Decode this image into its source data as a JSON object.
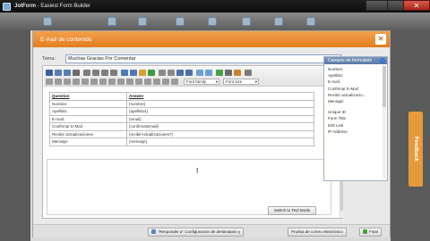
{
  "window": {
    "title_prefix": "JotForm",
    "title_suffix": " - Easiest Form Builder",
    "close_glyph": "✕"
  },
  "side_tab": {
    "label": "Feedback"
  },
  "modal": {
    "title": "E-mail de contenido",
    "close_glyph": "✕"
  },
  "subject": {
    "label": "Tema:",
    "value": "Muchas Gracias Por Comentar"
  },
  "editor": {
    "font_family_select": "Font family",
    "font_size_select": "Font size",
    "table": {
      "headers": [
        "Question",
        "Answer"
      ],
      "rows": [
        [
          "Nombre:",
          "{nombre}"
        ],
        [
          "Apellido:",
          "{apellido4}"
        ],
        [
          "E-mail:",
          "{email}"
        ],
        [
          "Confirmar E-Mail",
          "{confirmarEmail}"
        ],
        [
          "Recibir actualizaciones",
          "{recibirActualizaciones7}"
        ],
        [
          "Mensaje:",
          "{mensaje}"
        ]
      ]
    },
    "switch_button": "Switch to Text Mode"
  },
  "fields_panel": {
    "header": "Campos de formulario",
    "items": [
      "Nombre:",
      "Apellido:",
      "E-mail:",
      "Confirmar E-Mail",
      "Recibir actualizacio...",
      "Mensaje:"
    ],
    "meta_items": [
      "Unique ID",
      "Form Title",
      "Edit Link",
      "IP Address"
    ]
  },
  "footer": {
    "buttons": [
      "\"Responder a\" Configuración de destinatario y",
      "Prueba de correo electrónico",
      "Final"
    ]
  },
  "colors": {
    "modal_header": "#e8882c",
    "fields_header": "#6a86b0",
    "feedback_tab": "#e69a3c"
  }
}
